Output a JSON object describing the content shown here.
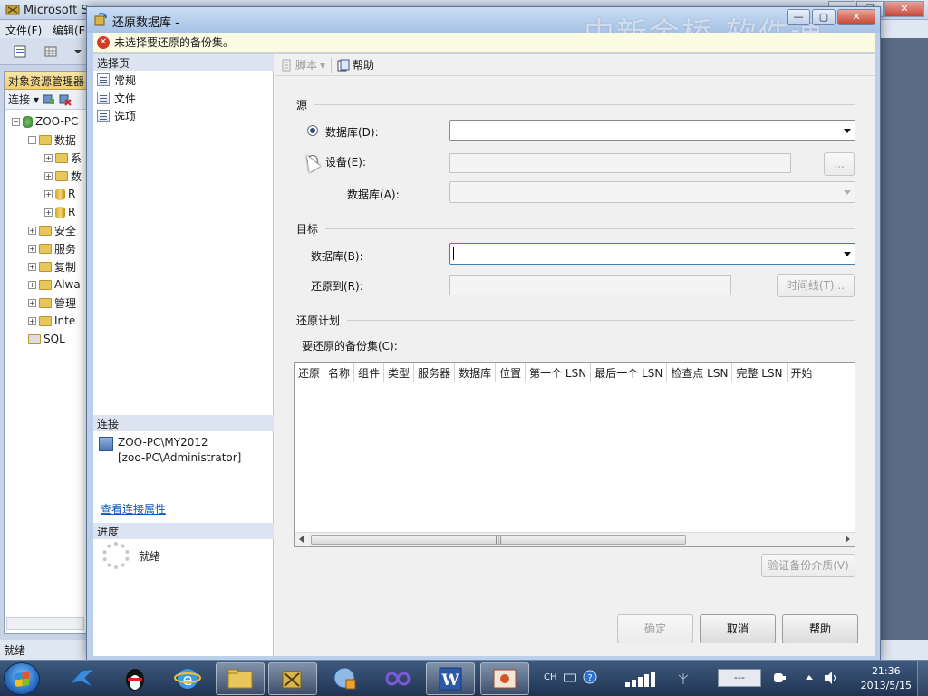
{
  "bg_app": {
    "title": "Microsoft S",
    "menu": [
      "文件(F)",
      "编辑(E"
    ],
    "oe_title": "对象资源管理器",
    "oe_connect": "连接",
    "tree": [
      {
        "label": "ZOO-PC",
        "indent": 0,
        "kind": "server"
      },
      {
        "label": "数据",
        "indent": 1,
        "kind": "folder"
      },
      {
        "label": "系",
        "indent": 2,
        "kind": "folder"
      },
      {
        "label": "数",
        "indent": 2,
        "kind": "folder"
      },
      {
        "label": "R",
        "indent": 2,
        "kind": "db"
      },
      {
        "label": "R",
        "indent": 2,
        "kind": "db"
      },
      {
        "label": "安全",
        "indent": 1,
        "kind": "folder"
      },
      {
        "label": "服务",
        "indent": 1,
        "kind": "folder"
      },
      {
        "label": "复制",
        "indent": 1,
        "kind": "folder"
      },
      {
        "label": "Alwa",
        "indent": 1,
        "kind": "folder"
      },
      {
        "label": "管理",
        "indent": 1,
        "kind": "folder"
      },
      {
        "label": "Inte",
        "indent": 1,
        "kind": "folder"
      },
      {
        "label": "SQL",
        "indent": 1,
        "kind": "agent"
      }
    ],
    "status": "就绪"
  },
  "dialog": {
    "title": "还原数据库 -",
    "watermark": "中新金桥 软件通",
    "error_message": "未选择要还原的备份集。",
    "toolbar": {
      "script": "脚本",
      "help": "帮助"
    },
    "left": {
      "select_page_header": "选择页",
      "pages": [
        "常规",
        "文件",
        "选项"
      ],
      "connection_header": "连接",
      "server": "ZOO-PC\\MY2012",
      "user": "[zoo-PC\\Administrator]",
      "view_props_link": "查看连接属性",
      "progress_header": "进度",
      "progress_status": "就绪"
    },
    "source": {
      "section": "源",
      "database_radio": "数据库(D):",
      "device_radio": "设备(E):",
      "device_browse": "...",
      "database_a": "数据库(A):"
    },
    "destination": {
      "section": "目标",
      "database_b": "数据库(B):",
      "restore_to": "还原到(R):",
      "timeline_button": "时间线(T)..."
    },
    "restore_plan": {
      "section": "还原计划",
      "backup_sets_label": "要还原的备份集(C):",
      "columns": [
        "还原",
        "名称",
        "组件",
        "类型",
        "服务器",
        "数据库",
        "位置",
        "第一个 LSN",
        "最后一个 LSN",
        "检查点 LSN",
        "完整 LSN",
        "开始"
      ],
      "verify_button": "验证备份介质(V)"
    },
    "buttons": {
      "ok": "确定",
      "cancel": "取消",
      "help": "帮助"
    }
  },
  "taskbar": {
    "lang": "CH",
    "clock_time": "21:36",
    "clock_date": "2013/5/15",
    "battery_text": "---"
  }
}
